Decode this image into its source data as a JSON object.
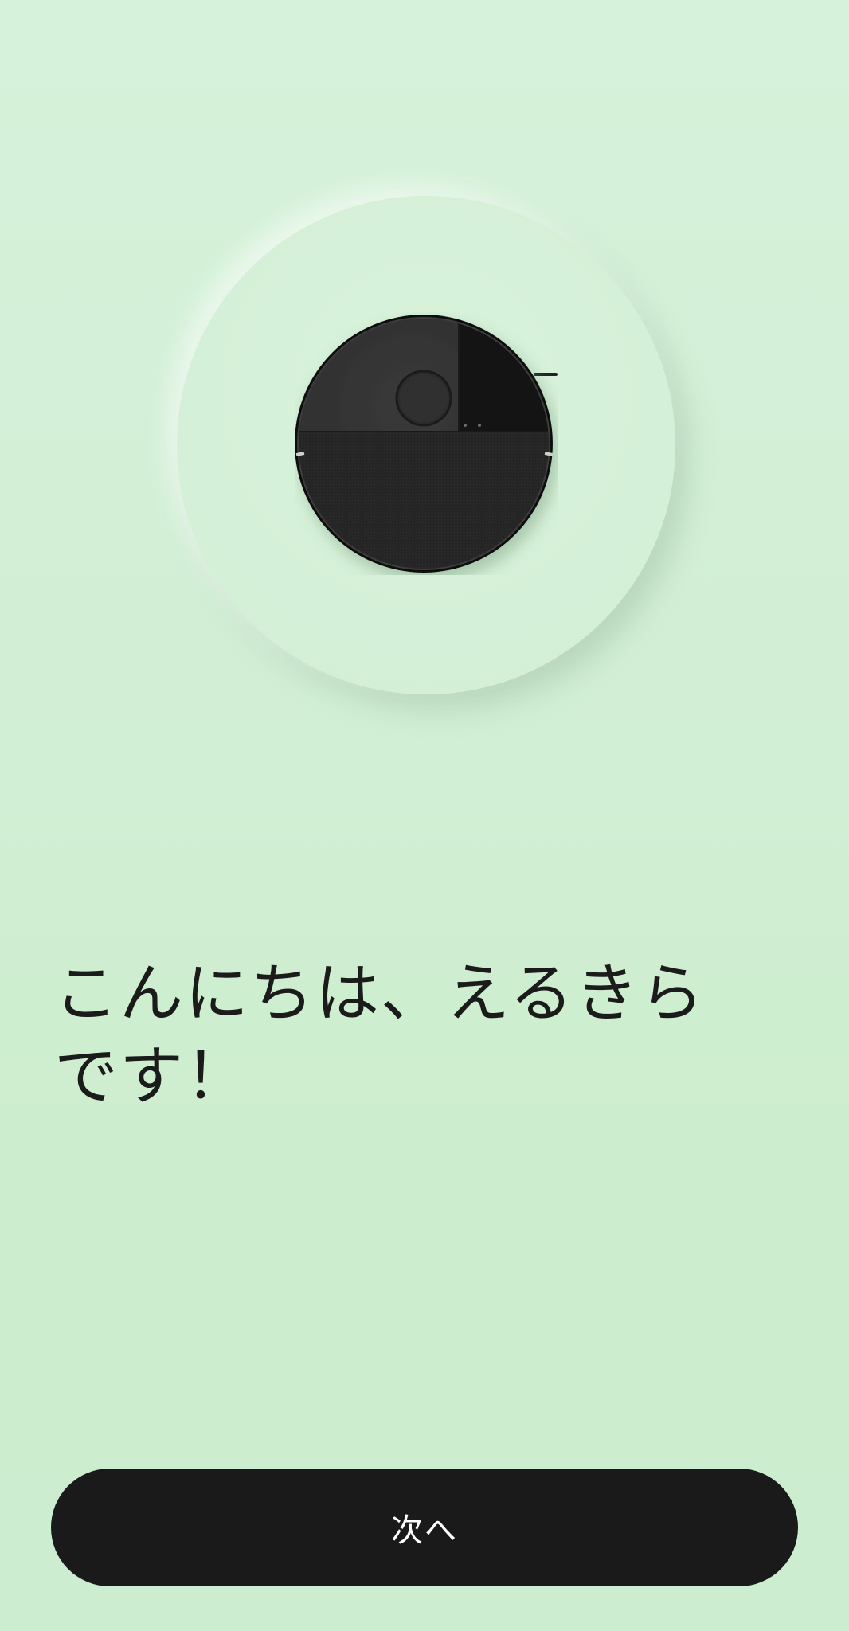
{
  "onboarding": {
    "robot_image": "robot-vacuum-icon",
    "greeting_text": "こんにちは、えるきら\nです！",
    "next_button_label": "次へ"
  },
  "colors": {
    "background": "#d2efd6",
    "button": "#1a1a1a",
    "button_text": "#ffffff",
    "text": "#1b1b1b"
  }
}
